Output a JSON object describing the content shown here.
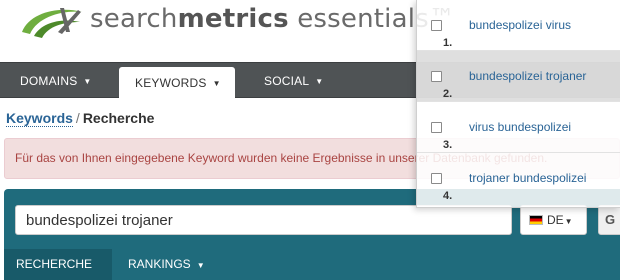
{
  "logo": {
    "prefix": "search",
    "bold": "metrics",
    "suffix": " essentials™"
  },
  "mainnav": {
    "domains": "DOMAINS",
    "keywords": "KEYWORDS",
    "social": "SOCIAL"
  },
  "breadcrumb": {
    "parent": "Keywords",
    "separator": "/",
    "current": "Recherche"
  },
  "alert": {
    "message": "Für das von Ihnen eingegebene Keyword wurden keine Ergebnisse in unserer Datenbank gefunden."
  },
  "search": {
    "value": "bundespolizei trojaner",
    "language": "DE",
    "go_label": "G"
  },
  "subtabs": {
    "recherche": "RECHERCHE",
    "rankings": "RANKINGS"
  },
  "suggestions": [
    {
      "num": "1.",
      "label": "bundespolizei virus"
    },
    {
      "num": "2.",
      "label": "bundespolizei trojaner"
    },
    {
      "num": "3.",
      "label": "virus bundespolizei"
    },
    {
      "num": "4.",
      "label": "trojaner bundespolizei"
    }
  ],
  "colors": {
    "nav_bg": "#4f5355",
    "panel_bg": "#1f6b7c",
    "link": "#2a6496",
    "alert_text": "#a94442",
    "logo_green": "#6fae3f"
  }
}
